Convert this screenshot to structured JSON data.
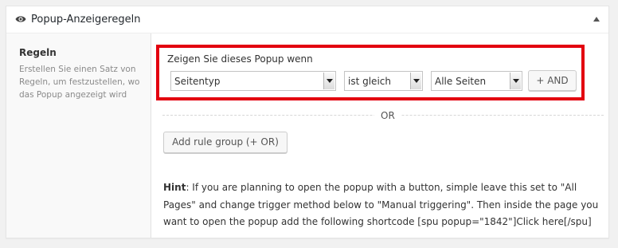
{
  "metabox": {
    "title": "Popup-Anzeigeregeln"
  },
  "sidebar": {
    "label": "Regeln",
    "description": "Erstellen Sie einen Satz von Regeln, um festzustellen, wo das Popup angezeigt wird"
  },
  "rule_group": {
    "heading": "Zeigen Sie dieses Popup wenn",
    "param_select": "Seitentyp",
    "operator_select": "ist gleich",
    "value_select": "Alle Seiten",
    "and_button": "+ AND"
  },
  "or_separator": "OR",
  "add_group_button": "Add rule group (+ OR)",
  "hint": {
    "label": "Hint",
    "text": ": If you are planning to open the popup with a button, simple leave this set to \"All Pages\" and change trigger method below to \"Manual triggering\". Then inside the page you want to open the popup add the following shortcode [spu popup=\"1842\"]Click here[/spu]"
  },
  "colors": {
    "highlight_border": "#e3000f",
    "panel_bg": "#ffffff",
    "sidebar_bg": "#f9f9f9"
  }
}
